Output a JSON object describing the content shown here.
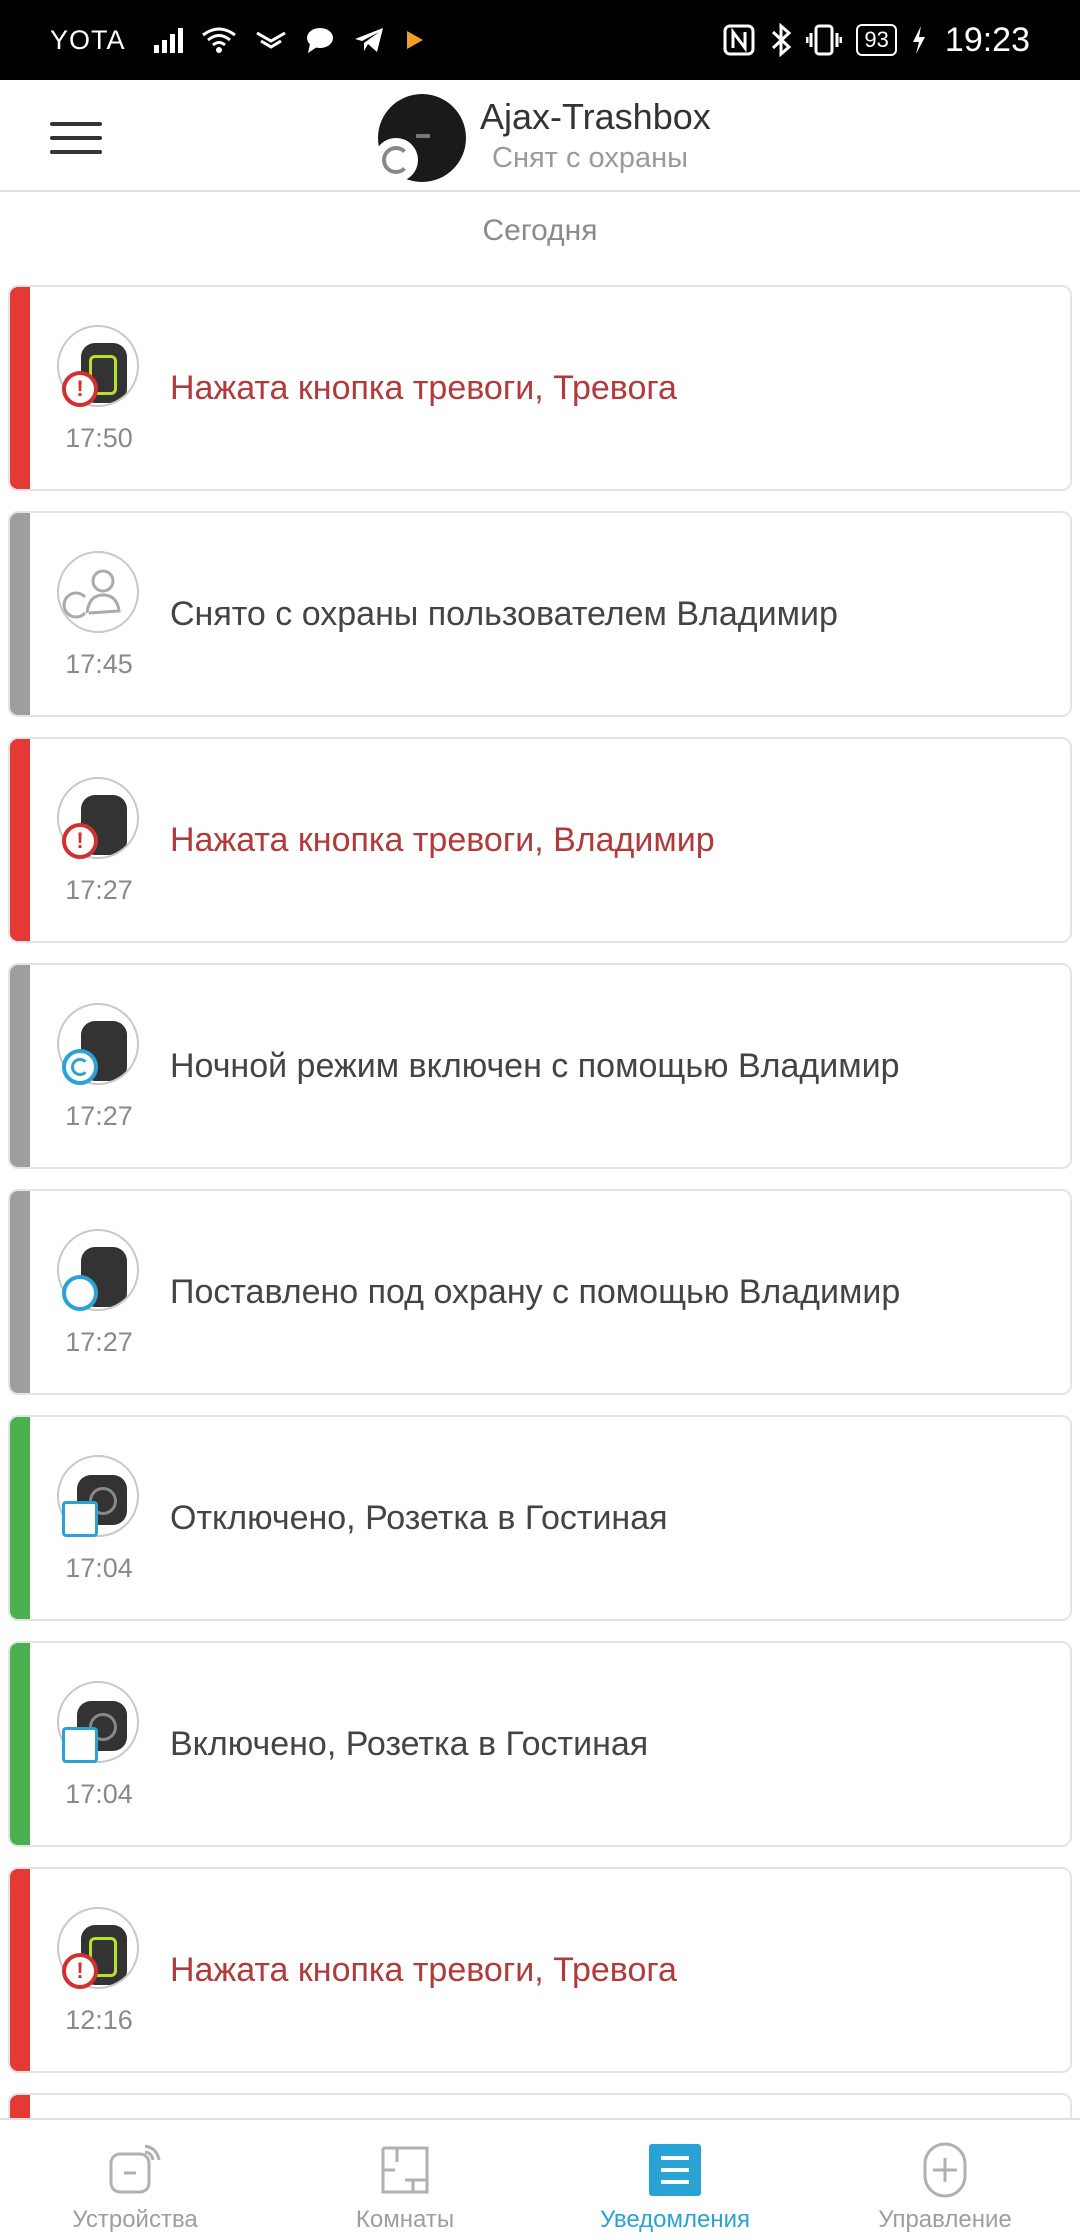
{
  "status_bar": {
    "carrier": "YOTA",
    "battery": "93",
    "time": "19:23"
  },
  "header": {
    "hub_name": "Ajax-Trashbox",
    "hub_status": "Снят с охраны"
  },
  "date_label": "Сегодня",
  "colors": {
    "alarm": "#e53935",
    "neutral": "#9e9e9e",
    "green": "#4caf50",
    "accent": "#29a3d6"
  },
  "events": [
    {
      "message": "Нажата кнопка тревоги, Тревога",
      "time": "17:50",
      "type": "alarm",
      "device": "button-green",
      "badge": "alarm"
    },
    {
      "message": "Снято с охраны пользователем Владимир",
      "time": "17:45",
      "type": "neutral",
      "device": "user",
      "badge": "none"
    },
    {
      "message": "Нажата кнопка тревоги, Владимир",
      "time": "17:27",
      "type": "alarm",
      "device": "keyfob",
      "badge": "alarm"
    },
    {
      "message": "Ночной режим включен с помощью Владимир",
      "time": "17:27",
      "type": "neutral",
      "device": "keyfob",
      "badge": "night"
    },
    {
      "message": "Поставлено под охрану с помощью Владимир",
      "time": "17:27",
      "type": "neutral",
      "device": "keyfob",
      "badge": "armed"
    },
    {
      "message": "Отключено, Розетка в Гостиная",
      "time": "17:04",
      "type": "green",
      "device": "socket",
      "badge": "socket-off"
    },
    {
      "message": "Включено, Розетка в Гостиная",
      "time": "17:04",
      "type": "green",
      "device": "socket",
      "badge": "socket-on"
    },
    {
      "message": "Нажата кнопка тревоги, Тревога",
      "time": "12:16",
      "type": "alarm",
      "device": "button-green",
      "badge": "alarm"
    }
  ],
  "bottom_nav": [
    {
      "label": "Устройства",
      "icon": "devices-icon",
      "active": false
    },
    {
      "label": "Комнаты",
      "icon": "rooms-icon",
      "active": false
    },
    {
      "label": "Уведомления",
      "icon": "notifications-icon",
      "active": true
    },
    {
      "label": "Управление",
      "icon": "control-icon",
      "active": false
    }
  ]
}
